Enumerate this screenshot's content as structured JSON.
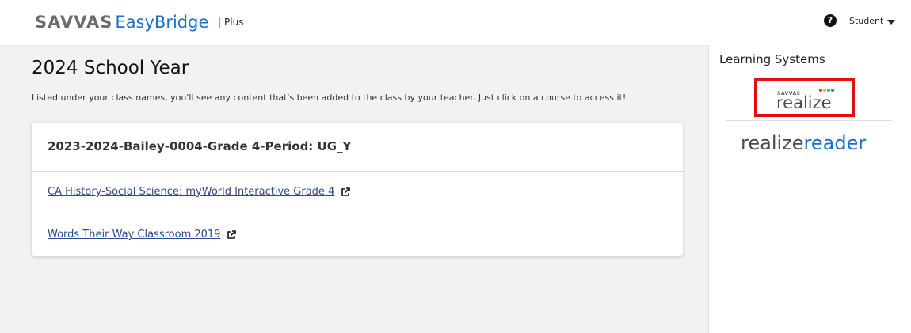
{
  "header": {
    "brand_primary": "SAVVAS",
    "brand_secondary": "EasyBridge",
    "plan_label": "Plus",
    "help_symbol": "?",
    "user_label": "Student"
  },
  "main": {
    "title": "2024 School Year",
    "subtitle": "Listed under your class names, you'll see any content that's been added to the class by your teacher. Just click on a course to access it!",
    "class": {
      "name": "2023-2024-Bailey-0004-Grade 4-Period: UG_Y",
      "courses": [
        {
          "label": "CA History-Social Science: myWorld Interactive Grade 4"
        },
        {
          "label": "Words Their Way Classroom 2019"
        }
      ]
    }
  },
  "side": {
    "title": "Learning Systems",
    "realize_small": "SAVVAS",
    "realize_word": "realize",
    "reader_part1": "realize",
    "reader_part2": "reader"
  },
  "colors": {
    "brand_blue": "#1a73c8",
    "link": "#2b4a8c",
    "highlight_red": "#e01010",
    "dot_red": "#e5322d",
    "dot_yellow": "#f2b21b",
    "dot_green": "#3cb34a",
    "dot_blue": "#2a7de1"
  },
  "icons": {
    "help": "help-icon",
    "dropdown": "chevron-down-icon",
    "external": "external-link-icon"
  }
}
